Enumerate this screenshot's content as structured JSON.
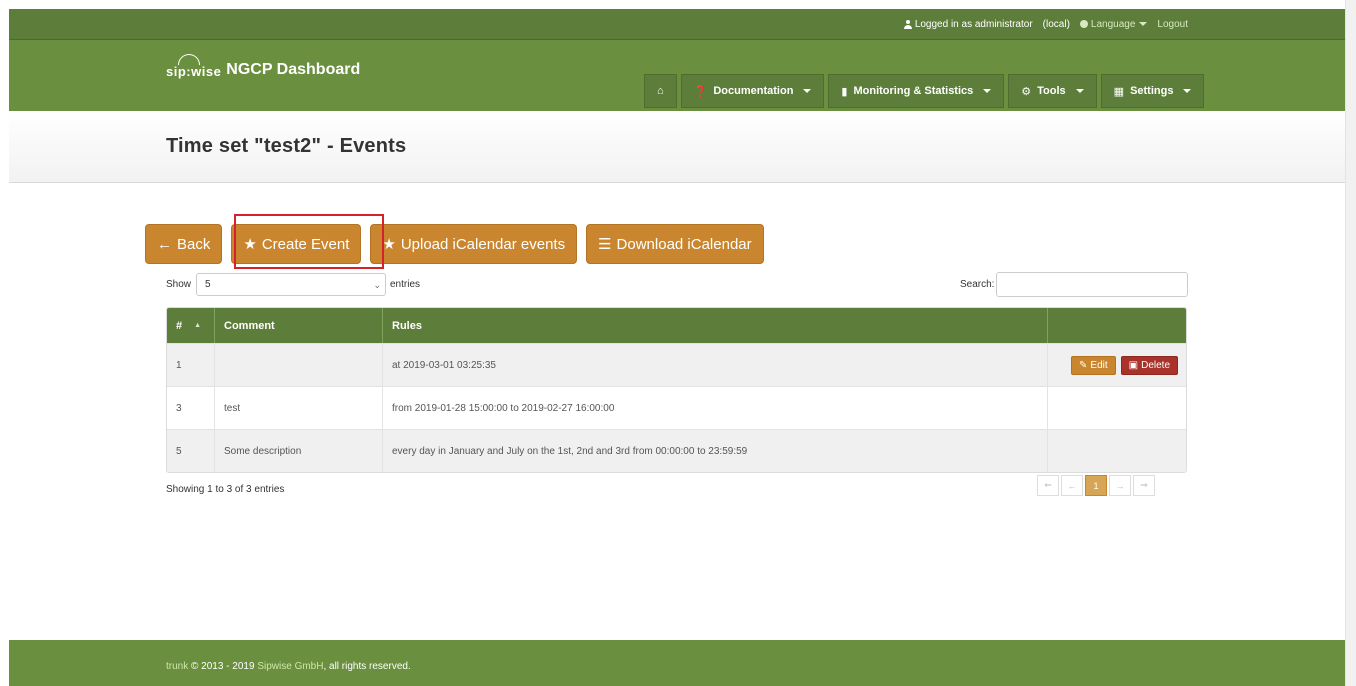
{
  "topbar": {
    "logged_in": "Logged in as administrator",
    "realm": "(local)",
    "language": "Language",
    "logout": "Logout"
  },
  "header": {
    "logo_mark": "sip:wise",
    "logo_title": "NGCP Dashboard",
    "nav": [
      {
        "label": "",
        "icon": "home-icon"
      },
      {
        "label": "Documentation",
        "icon": "question-icon"
      },
      {
        "label": "Monitoring & Statistics",
        "icon": "signal-icon"
      },
      {
        "label": "Tools",
        "icon": "gear-icon"
      },
      {
        "label": "Settings",
        "icon": "grid-icon"
      }
    ]
  },
  "page": {
    "title": "Time set \"test2\" - Events"
  },
  "actions": {
    "back": "Back",
    "create": "Create Event",
    "upload": "Upload iCalendar events",
    "download": "Download iCalendar"
  },
  "controls": {
    "show": "Show",
    "length_value": "5",
    "entries": "entries",
    "search": "Search:"
  },
  "table": {
    "headers": [
      "#",
      "Comment",
      "Rules",
      ""
    ],
    "rows": [
      {
        "id": "1",
        "comment": "",
        "rules": "at 2019-03-01 03:25:35",
        "edit": "Edit",
        "delete": "Delete"
      },
      {
        "id": "3",
        "comment": "test",
        "rules": "from 2019-01-28 15:00:00 to 2019-02-27 16:00:00"
      },
      {
        "id": "5",
        "comment": "Some description",
        "rules": "every day in January and July on the 1st, 2nd and 3rd from 00:00:00 to 23:59:59"
      }
    ]
  },
  "info": "Showing 1 to 3 of 3 entries",
  "pager": {
    "first": "⇐",
    "prev": "←",
    "current": "1",
    "next": "→",
    "last": "⇒"
  },
  "footer": {
    "trunk": "trunk",
    "copyright": " © 2013 - 2019 ",
    "company": "Sipwise GmbH",
    "rights": ", all rights reserved."
  },
  "colors": {
    "header_green": "#6a8f3f",
    "button_orange": "#c9862e",
    "delete_red": "#a9322a",
    "highlight_red": "#d6202a"
  }
}
